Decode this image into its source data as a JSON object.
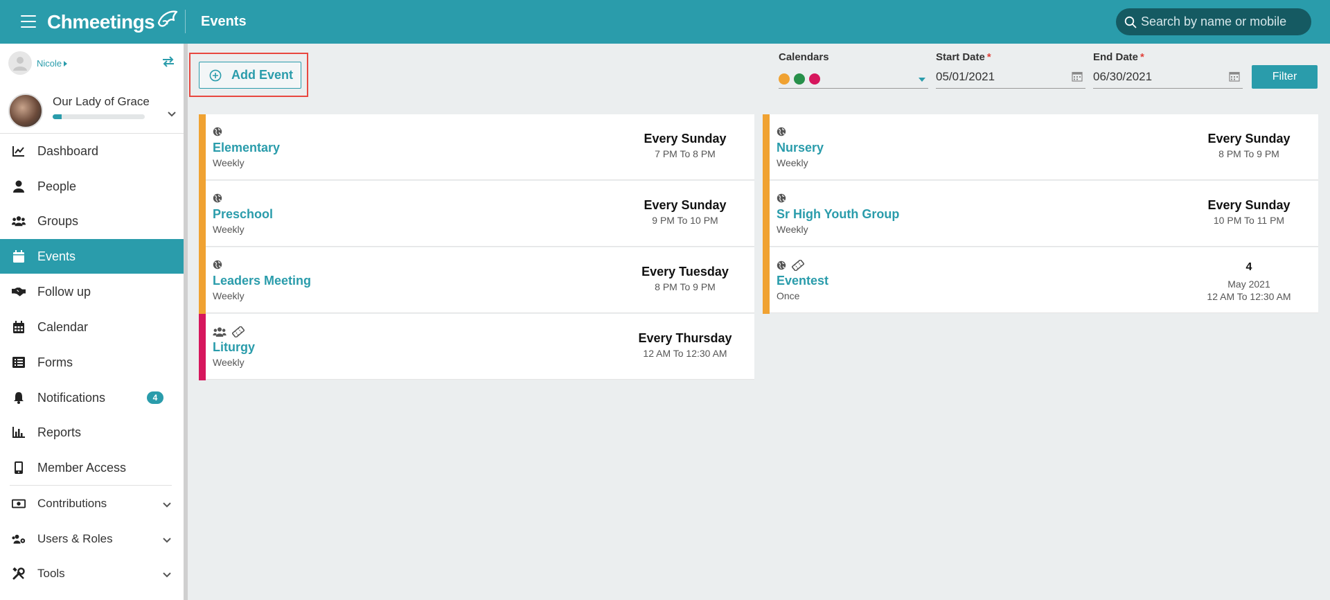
{
  "app": {
    "brand": "Chmeetings",
    "page_title": "Events",
    "search_placeholder": "Search by name or mobile"
  },
  "user": {
    "name": "Nicole"
  },
  "church": {
    "name": "Our Lady of Grace",
    "progress_fraction": 0.1
  },
  "nav": [
    {
      "label": "Dashboard",
      "icon": "chart-line-icon"
    },
    {
      "label": "People",
      "icon": "person-icon"
    },
    {
      "label": "Groups",
      "icon": "users-icon"
    },
    {
      "label": "Events",
      "icon": "calendar-icon",
      "active": true
    },
    {
      "label": "Follow up",
      "icon": "handshake-icon"
    },
    {
      "label": "Calendar",
      "icon": "calendar-grid-icon"
    },
    {
      "label": "Forms",
      "icon": "list-icon"
    },
    {
      "label": "Notifications",
      "icon": "bell-icon",
      "badge": "4"
    },
    {
      "label": "Reports",
      "icon": "bar-chart-icon"
    },
    {
      "label": "Member Access",
      "icon": "mobile-icon"
    },
    {
      "label": "Contributions",
      "icon": "money-icon",
      "expandable": true
    },
    {
      "label": "Users & Roles",
      "icon": "users-cog-icon",
      "expandable": true
    },
    {
      "label": "Tools",
      "icon": "tools-icon",
      "expandable": true
    }
  ],
  "toolbar": {
    "add_event_label": "Add Event",
    "calendars_label": "Calendars",
    "calendar_colors": [
      "#f0a232",
      "#27904a",
      "#d6175d"
    ],
    "start_date_label": "Start Date",
    "start_date_value": "05/01/2021",
    "end_date_label": "End Date",
    "end_date_value": "06/30/2021",
    "required_mark": "*",
    "filter_label": "Filter"
  },
  "events_left": [
    {
      "title": "Elementary",
      "frequency": "Weekly",
      "when": "Every Sunday",
      "time": "7 PM To 8 PM",
      "color": "#f0a232",
      "icons": [
        "globe-icon"
      ]
    },
    {
      "title": "Preschool",
      "frequency": "Weekly",
      "when": "Every Sunday",
      "time": "9 PM To 10 PM",
      "color": "#f0a232",
      "icons": [
        "globe-icon"
      ]
    },
    {
      "title": "Leaders Meeting",
      "frequency": "Weekly",
      "when": "Every Tuesday",
      "time": "8 PM To 9 PM",
      "color": "#f0a232",
      "icons": [
        "globe-icon"
      ]
    },
    {
      "title": "Liturgy",
      "frequency": "Weekly",
      "when": "Every Thursday",
      "time": "12 AM To 12:30 AM",
      "color": "#d6175d",
      "icons": [
        "users-icon",
        "ticket-icon"
      ]
    }
  ],
  "events_right": [
    {
      "title": "Nursery",
      "frequency": "Weekly",
      "when": "Every Sunday",
      "time": "8 PM To 9 PM",
      "color": "#f0a232",
      "icons": [
        "globe-icon"
      ]
    },
    {
      "title": "Sr High Youth Group",
      "frequency": "Weekly",
      "when": "Every Sunday",
      "time": "10 PM To 11 PM",
      "color": "#f0a232",
      "icons": [
        "globe-icon"
      ]
    },
    {
      "title": "Eventest",
      "frequency": "Once",
      "day": "4",
      "month": "May 2021",
      "time": "12 AM To 12:30 AM",
      "color": "#f0a232",
      "icons": [
        "globe-icon",
        "ticket-icon"
      ]
    }
  ]
}
